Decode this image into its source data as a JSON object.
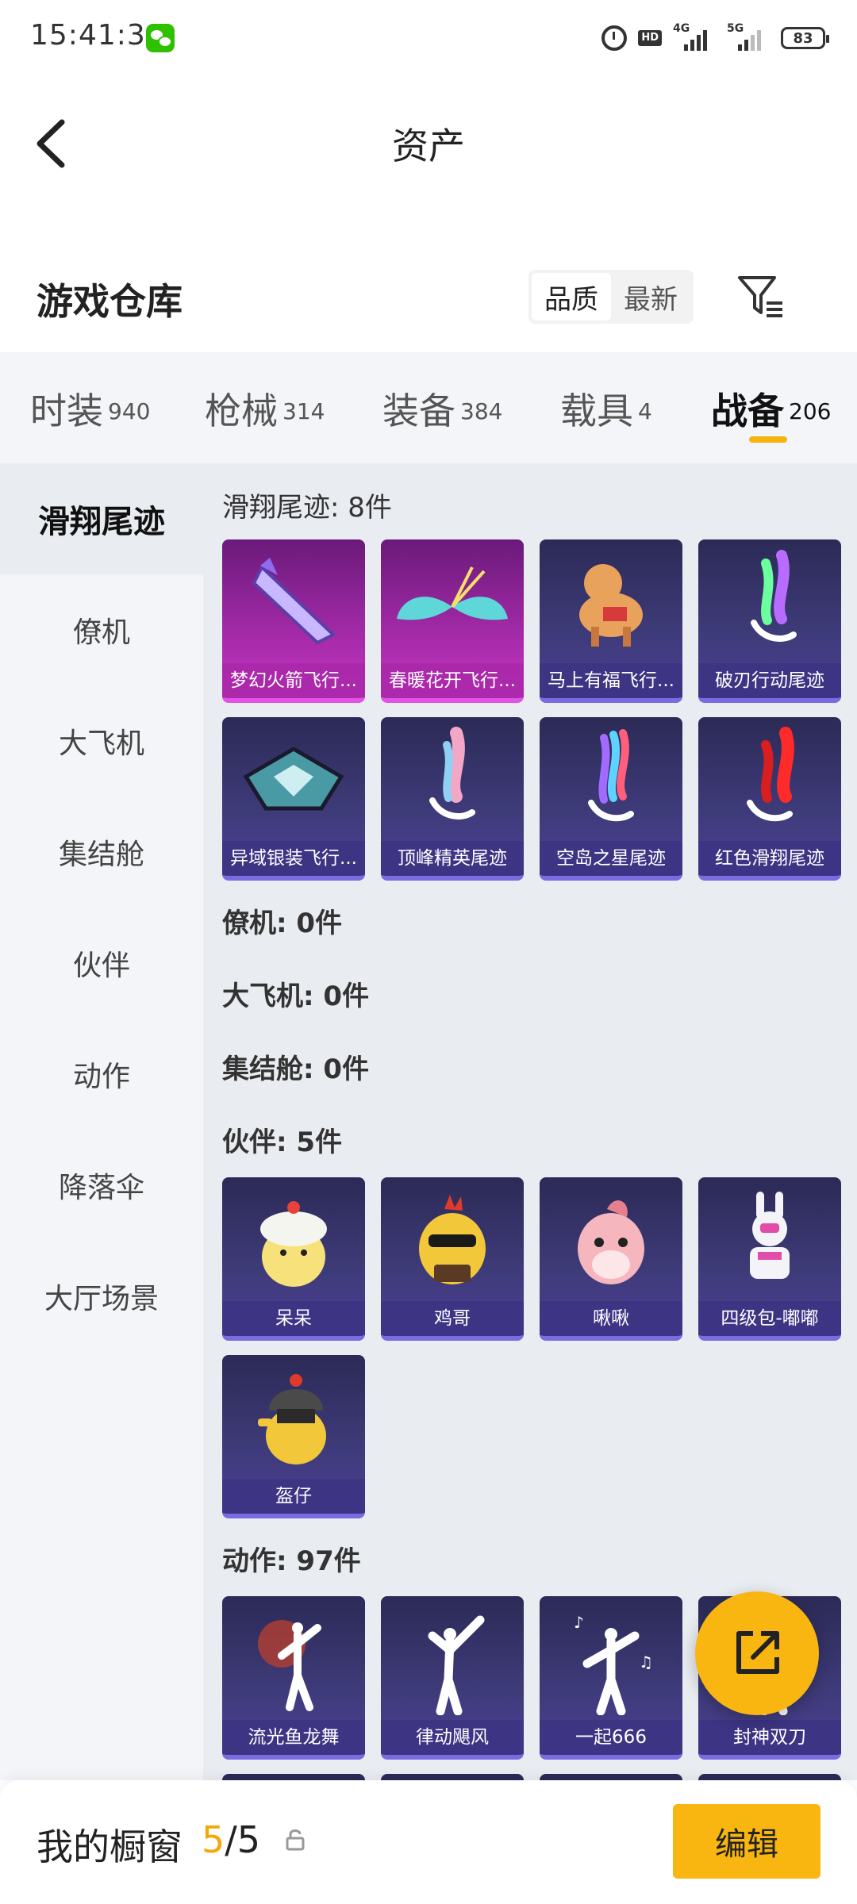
{
  "status_bar": {
    "time": "15:41:34",
    "hd_badge": "HD1\nHD2",
    "network_4g": "4G",
    "network_5g": "5G",
    "battery": "83"
  },
  "nav": {
    "title": "资产"
  },
  "warehouse": {
    "title": "游戏仓库",
    "sort_options": [
      "品质",
      "最新"
    ],
    "sort_selected": "品质"
  },
  "category_tabs": [
    {
      "label": "时装",
      "count": "940"
    },
    {
      "label": "枪械",
      "count": "314"
    },
    {
      "label": "装备",
      "count": "384"
    },
    {
      "label": "载具",
      "count": "4"
    },
    {
      "label": "战备",
      "count": "206"
    }
  ],
  "active_category": "战备",
  "sidebar": [
    "滑翔尾迹",
    "僚机",
    "大飞机",
    "集结舱",
    "伙伴",
    "动作",
    "降落伞",
    "大厅场景"
  ],
  "active_sidebar": "滑翔尾迹",
  "sections": [
    {
      "header": "滑翔尾迹: 8件",
      "items": [
        {
          "name": "梦幻火箭飞行...",
          "rarity": "purple",
          "art": "rocket-glider"
        },
        {
          "name": "春暖花开飞行...",
          "rarity": "purple",
          "art": "butterfly-glider"
        },
        {
          "name": "马上有福飞行...",
          "rarity": "blue",
          "art": "horse-glider"
        },
        {
          "name": "破刃行动尾迹",
          "rarity": "blue",
          "art": "trail-multicolor"
        },
        {
          "name": "异域银装飞行...",
          "rarity": "blue",
          "art": "silver-glider"
        },
        {
          "name": "顶峰精英尾迹",
          "rarity": "blue",
          "art": "trail-pastel"
        },
        {
          "name": "空岛之星尾迹",
          "rarity": "blue",
          "art": "trail-rainbow"
        },
        {
          "name": "红色滑翔尾迹",
          "rarity": "blue",
          "art": "trail-red"
        }
      ]
    },
    {
      "header": "僚机: 0件",
      "items": []
    },
    {
      "header": "大飞机: 0件",
      "items": []
    },
    {
      "header": "集结舱: 0件",
      "items": []
    },
    {
      "header": "伙伴: 5件",
      "items": [
        {
          "name": "呆呆",
          "rarity": "blue",
          "art": "chick-white"
        },
        {
          "name": "鸡哥",
          "rarity": "blue",
          "art": "chick-sunglasses"
        },
        {
          "name": "啾啾",
          "rarity": "blue",
          "art": "bird-pink"
        },
        {
          "name": "四级包-嘟嘟",
          "rarity": "blue",
          "art": "robot-bunny"
        },
        {
          "name": "盔仔",
          "rarity": "blue",
          "art": "chick-helmet"
        }
      ]
    },
    {
      "header": "动作: 97件",
      "items": [
        {
          "name": "流光鱼龙舞",
          "rarity": "blue",
          "art": "dance-flower"
        },
        {
          "name": "律动飓风",
          "rarity": "blue",
          "art": "dance-pose"
        },
        {
          "name": "一起666",
          "rarity": "blue",
          "art": "dance-music"
        },
        {
          "name": "封神双刀",
          "rarity": "blue",
          "art": "dance-blades"
        }
      ]
    }
  ],
  "showcase": {
    "title": "我的橱窗",
    "current": "5",
    "separator": "/",
    "total": "5",
    "edit_label": "编辑"
  },
  "colors": {
    "accent": "#f9b611",
    "count_highlight": "#f4a80c",
    "card_blue": "#3e3b7a",
    "card_purple": "#a42aa8"
  }
}
